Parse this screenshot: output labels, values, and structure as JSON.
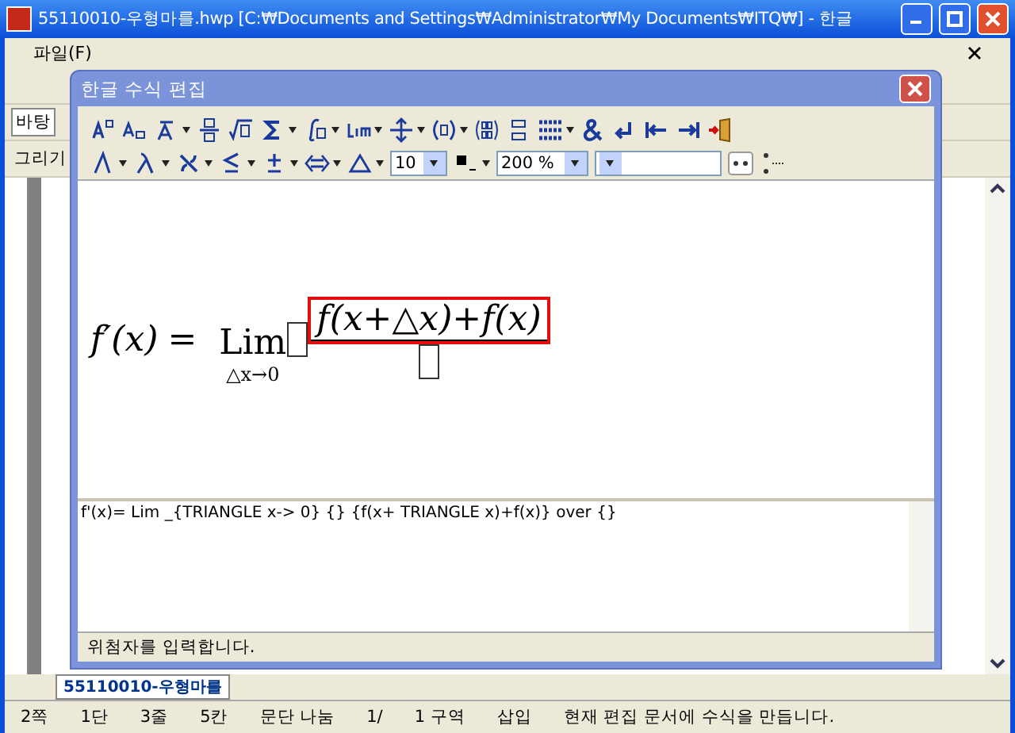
{
  "window": {
    "title": "55110010-우형마를.hwp [C:₩Documents and Settings₩Administrator₩My Documents₩ITQ₩] - 한글"
  },
  "menu": [
    "파일(F)"
  ],
  "side_labels": [
    "바탕",
    "그리기"
  ],
  "dialog": {
    "title": "한글 수식 편집",
    "font_size": "10",
    "zoom": "200 %",
    "equation": {
      "lhs": "f′(x)",
      "equals": "=",
      "operator": "Lim",
      "subscript": "△x→0",
      "numerator": "f(x+△x)+f(x)",
      "numerator_selected": true
    },
    "script": "f'(x)= Lim _{TRIANGLE x-> 0} {} {f(x+ TRIANGLE x)+f(x)} over {}",
    "status": "위첨자를 입력합니다."
  },
  "doc_tab": "55110010-우형마를",
  "status_bar": [
    "2쪽",
    "1단",
    "3줄",
    "5칸",
    "문단 나눔",
    "1/",
    "1 구역",
    "삽입",
    "현재 편집 문서에 수식을 만듭니다."
  ]
}
